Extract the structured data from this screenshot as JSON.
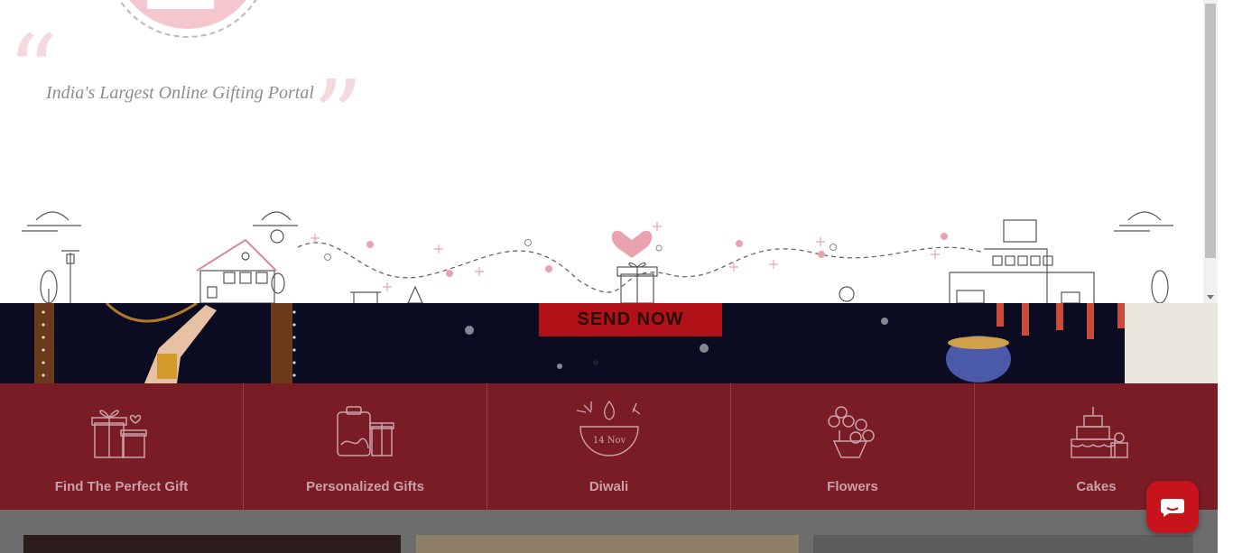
{
  "hero": {
    "tagline": "India's Largest Online Gifting Portal"
  },
  "banner": {
    "send_label": "SEND NOW"
  },
  "categories": [
    {
      "label": "Find The Perfect Gift",
      "icon": "gift-boxes-icon"
    },
    {
      "label": "Personalized Gifts",
      "icon": "personalized-gift-icon"
    },
    {
      "label": "Diwali",
      "icon": "diya-icon",
      "date_text": "14 Nov"
    },
    {
      "label": "Flowers",
      "icon": "flower-bouquet-icon"
    },
    {
      "label": "Cakes",
      "icon": "cake-icon"
    }
  ],
  "colors": {
    "brand_red": "#b01217",
    "category_bg": "#7a1c26",
    "pink_accent": "#e8a3ae"
  }
}
